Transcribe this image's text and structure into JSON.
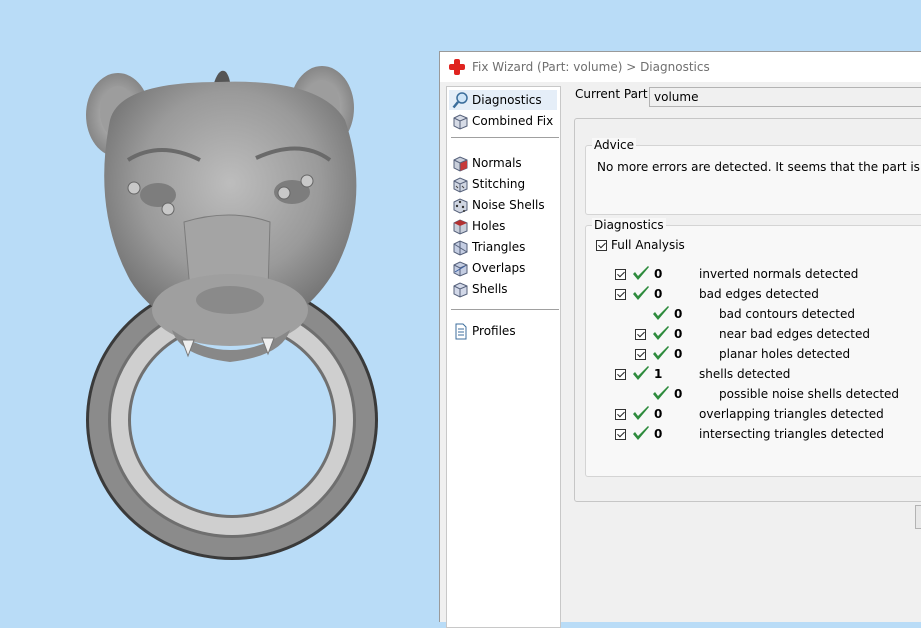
{
  "window": {
    "title": "Fix Wizard (Part: volume) > Diagnostics"
  },
  "nav": {
    "items": [
      {
        "label": "Diagnostics",
        "icon": "magnifier-icon",
        "selected": true
      },
      {
        "label": "Combined Fix",
        "icon": "combined-fix-cube-icon"
      },
      {
        "label": "Normals",
        "icon": "normals-cube-icon"
      },
      {
        "label": "Stitching",
        "icon": "stitching-cube-icon"
      },
      {
        "label": "Noise Shells",
        "icon": "noise-shells-cube-icon"
      },
      {
        "label": "Holes",
        "icon": "holes-cube-icon"
      },
      {
        "label": "Triangles",
        "icon": "triangles-cube-icon"
      },
      {
        "label": "Overlaps",
        "icon": "overlaps-cube-icon"
      },
      {
        "label": "Shells",
        "icon": "shells-cube-icon"
      },
      {
        "label": "Profiles",
        "icon": "document-icon"
      }
    ]
  },
  "current_part": {
    "label": "Current Part:",
    "value": "volume"
  },
  "advice": {
    "title": "Advice",
    "text": "No more errors are detected. It seems that the part is ok."
  },
  "diagnostics": {
    "title": "Diagnostics",
    "full_analysis": {
      "label": "Full Analysis",
      "checked": true
    },
    "rows": [
      {
        "checkbox": true,
        "count": "0",
        "label": "inverted normals detected",
        "indent": 0
      },
      {
        "checkbox": true,
        "count": "0",
        "label": "bad edges detected",
        "indent": 0
      },
      {
        "checkbox": false,
        "count": "0",
        "label": "bad contours detected",
        "indent": 1
      },
      {
        "checkbox": true,
        "count": "0",
        "label": "near bad edges detected",
        "indent": 1
      },
      {
        "checkbox": true,
        "count": "0",
        "label": "planar holes detected",
        "indent": 1
      },
      {
        "checkbox": true,
        "count": "1",
        "label": "shells detected",
        "indent": 0
      },
      {
        "checkbox": false,
        "count": "0",
        "label": "possible noise shells detected",
        "indent": 1
      },
      {
        "checkbox": true,
        "count": "0",
        "label": "overlapping triangles detected",
        "indent": 0
      },
      {
        "checkbox": true,
        "count": "0",
        "label": "intersecting triangles detected",
        "indent": 0
      }
    ]
  },
  "colors": {
    "viewport_bg": "#b9dcf7",
    "model_gray": "#8f8f8f",
    "tick_green": "#2e8b3d",
    "cross_red": "#e0231f"
  }
}
